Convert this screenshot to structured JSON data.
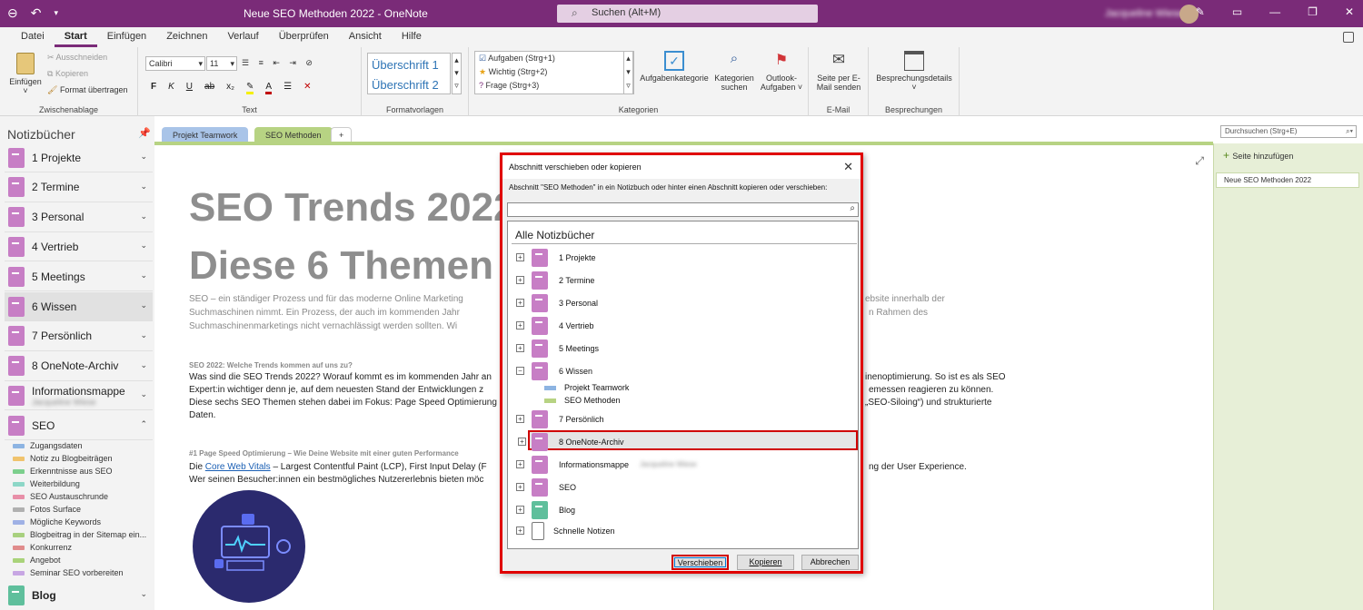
{
  "titlebar": {
    "title": "Neue SEO Methoden 2022  -  OneNote",
    "search_placeholder": "Suchen (Alt+M)",
    "user": "Jacqueline Wiese"
  },
  "menu": [
    "Datei",
    "Start",
    "Einfügen",
    "Zeichnen",
    "Verlauf",
    "Überprüfen",
    "Ansicht",
    "Hilfe"
  ],
  "ribbon": {
    "clipboard": {
      "paste": "Einfügen",
      "cut": "Ausschneiden",
      "copy": "Kopieren",
      "format": "Format übertragen",
      "label": "Zwischenablage"
    },
    "text": {
      "font": "Calibri",
      "size": "11",
      "label": "Text",
      "bold": "F",
      "italic": "K",
      "underline": "U",
      "strike": "ab",
      "sub": "x₂"
    },
    "styles": {
      "h1": "Überschrift 1",
      "h2": "Überschrift 2",
      "label": "Formatvorlagen"
    },
    "tags": {
      "items": [
        "Aufgaben (Strg+1)",
        "Wichtig (Strg+2)",
        "Frage (Strg+3)"
      ],
      "task": "Aufgabenkategorie",
      "find_l1": "Kategorien",
      "find_l2": "suchen",
      "outlook_l1": "Outlook-",
      "outlook_l2": "Aufgaben",
      "label": "Kategorien"
    },
    "email": {
      "l1": "Seite per E-",
      "l2": "Mail senden",
      "label": "E-Mail"
    },
    "meetings": {
      "l1": "Besprechungsdetails",
      "label": "Besprechungen"
    }
  },
  "left": {
    "header": "Notizbücher",
    "notebooks": [
      {
        "name": "1 Projekte",
        "color": "#c77ec5"
      },
      {
        "name": "2 Termine",
        "color": "#c77ec5"
      },
      {
        "name": "3 Personal",
        "color": "#c77ec5"
      },
      {
        "name": "4 Vertrieb",
        "color": "#c77ec5"
      },
      {
        "name": "5 Meetings",
        "color": "#c77ec5"
      },
      {
        "name": "6 Wissen",
        "color": "#c77ec5"
      },
      {
        "name": "7 Persönlich",
        "color": "#c77ec5"
      },
      {
        "name": "8 OneNote-Archiv",
        "color": "#c77ec5"
      },
      {
        "name": "Informationsmappe",
        "color": "#c77ec5"
      },
      {
        "name": "SEO",
        "color": "#c77ec5"
      }
    ],
    "seo_sections": [
      {
        "name": "Zugangsdaten",
        "color": "#8db4e2"
      },
      {
        "name": "Notiz zu Blogbeiträgen",
        "color": "#f0c36d"
      },
      {
        "name": "Erkenntnisse aus SEO",
        "color": "#7ccf8d"
      },
      {
        "name": "Weiterbildung",
        "color": "#8dd7c7"
      },
      {
        "name": "SEO Austauschrunde",
        "color": "#e88fa8"
      },
      {
        "name": "Fotos Surface",
        "color": "#b0b0b0"
      },
      {
        "name": "Mögliche Keywords",
        "color": "#9fb1e5"
      },
      {
        "name": "Blogbeitrag in der Sitemap ein...",
        "color": "#a8d07f"
      },
      {
        "name": "Konkurrenz",
        "color": "#e08c8c"
      },
      {
        "name": "Angebot",
        "color": "#a9d37a"
      },
      {
        "name": "Seminar SEO vorbereiten",
        "color": "#c7a6e3"
      }
    ],
    "last_notebook": "Blog"
  },
  "tabs": {
    "t1": "Projekt Teamwork",
    "t2": "SEO Methoden",
    "add": "+"
  },
  "page": {
    "title1": "SEO Trends 2022",
    "title2": "Diese 6 Themen",
    "intro1": "SEO – ein ständiger Prozess und für das moderne Online Marketing",
    "intro2": "Suchmaschinen nimmt. Ein Prozess, der auch im kommenden Jahr",
    "intro3": "Suchmaschinenmarketings nicht vernachlässigt werden sollten. Wi",
    "intro_r1": "ebsite innerhalb der",
    "intro_r2": "n Rahmen des",
    "h2a": "SEO 2022: Welche Trends kommen auf uns zu?",
    "p1": "Was sind die SEO Trends 2022? Worauf kommt es im kommenden Jahr an",
    "p2": "Expert:in wichtiger denn je, auf dem neuesten Stand der Entwicklungen z",
    "p3": "Diese sechs SEO Themen stehen dabei im Fokus: Page Speed Optimierung",
    "p4": "Daten.",
    "p1r": "inenoptimierung. So ist es als SEO",
    "p2r": "emessen reagieren zu können.",
    "p3r": "„SEO-Siloing“) und strukturierte",
    "h2b": "#1 Page Speed Optimierung – Wie Deine Website mit einer guten Performance",
    "q1a": "Die ",
    "q1link": "Core Web Vitals",
    "q1b": " – Largest Contentful Paint (LCP), First Input Delay (F",
    "q1r": "ng der User Experience.",
    "q2": "Wer seinen Besucher:innen ein bestmögliches Nutzererlebnis bieten möc"
  },
  "right": {
    "search": "Durchsuchen (Strg+E)",
    "add_page": "Seite hinzufügen",
    "page1": "Neue SEO Methoden 2022"
  },
  "dialog": {
    "title": "Abschnitt verschieben oder kopieren",
    "instruction": "Abschnitt \"SEO Methoden\" in ein Notizbuch oder hinter einen Abschnitt kopieren oder verschieben:",
    "tree_header": "Alle Notizbücher",
    "items": [
      "1 Projekte",
      "2 Termine",
      "3 Personal",
      "4 Vertrieb",
      "5 Meetings",
      "6 Wissen"
    ],
    "wissen_sections": [
      "Projekt Teamwork",
      "SEO Methoden"
    ],
    "items2": [
      "7 Persönlich",
      "8 OneNote-Archiv",
      "Informationsmappe",
      "SEO",
      "Blog",
      "Schnelle Notizen"
    ],
    "move": "Verschieben",
    "copy": "Kopieren",
    "cancel": "Abbrechen"
  },
  "colors": {
    "accent": "#7a2b78",
    "highlight": "#d00000",
    "section_green": "#b7d383"
  }
}
